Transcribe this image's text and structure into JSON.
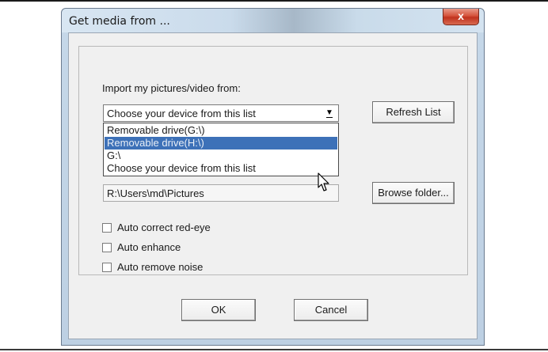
{
  "window": {
    "title": "Get media from ...",
    "close_glyph": "x"
  },
  "import": {
    "label": "Import my pictures/video from:",
    "combo_value": "Choose your device from this list",
    "dropdown_items": [
      "Removable drive(G:\\)",
      "Removable drive(H:\\)",
      "G:\\",
      "Choose your device from this list"
    ],
    "selected_index": 1
  },
  "refresh_button": "Refresh List",
  "folder_path": "R:\\Users\\md\\Pictures",
  "browse_button": "Browse folder...",
  "options": [
    {
      "label": "Auto correct red-eye",
      "checked": false
    },
    {
      "label": "Auto enhance",
      "checked": false
    },
    {
      "label": "Auto remove noise",
      "checked": false
    }
  ],
  "ok_button": "OK",
  "cancel_button": "Cancel",
  "icons": {
    "cursor": "arrow-cursor-icon",
    "combo_arrow": "chevron-down-icon",
    "close": "close-icon"
  },
  "colors": {
    "selection": "#3d71b8",
    "close_button": "#c0321e"
  }
}
